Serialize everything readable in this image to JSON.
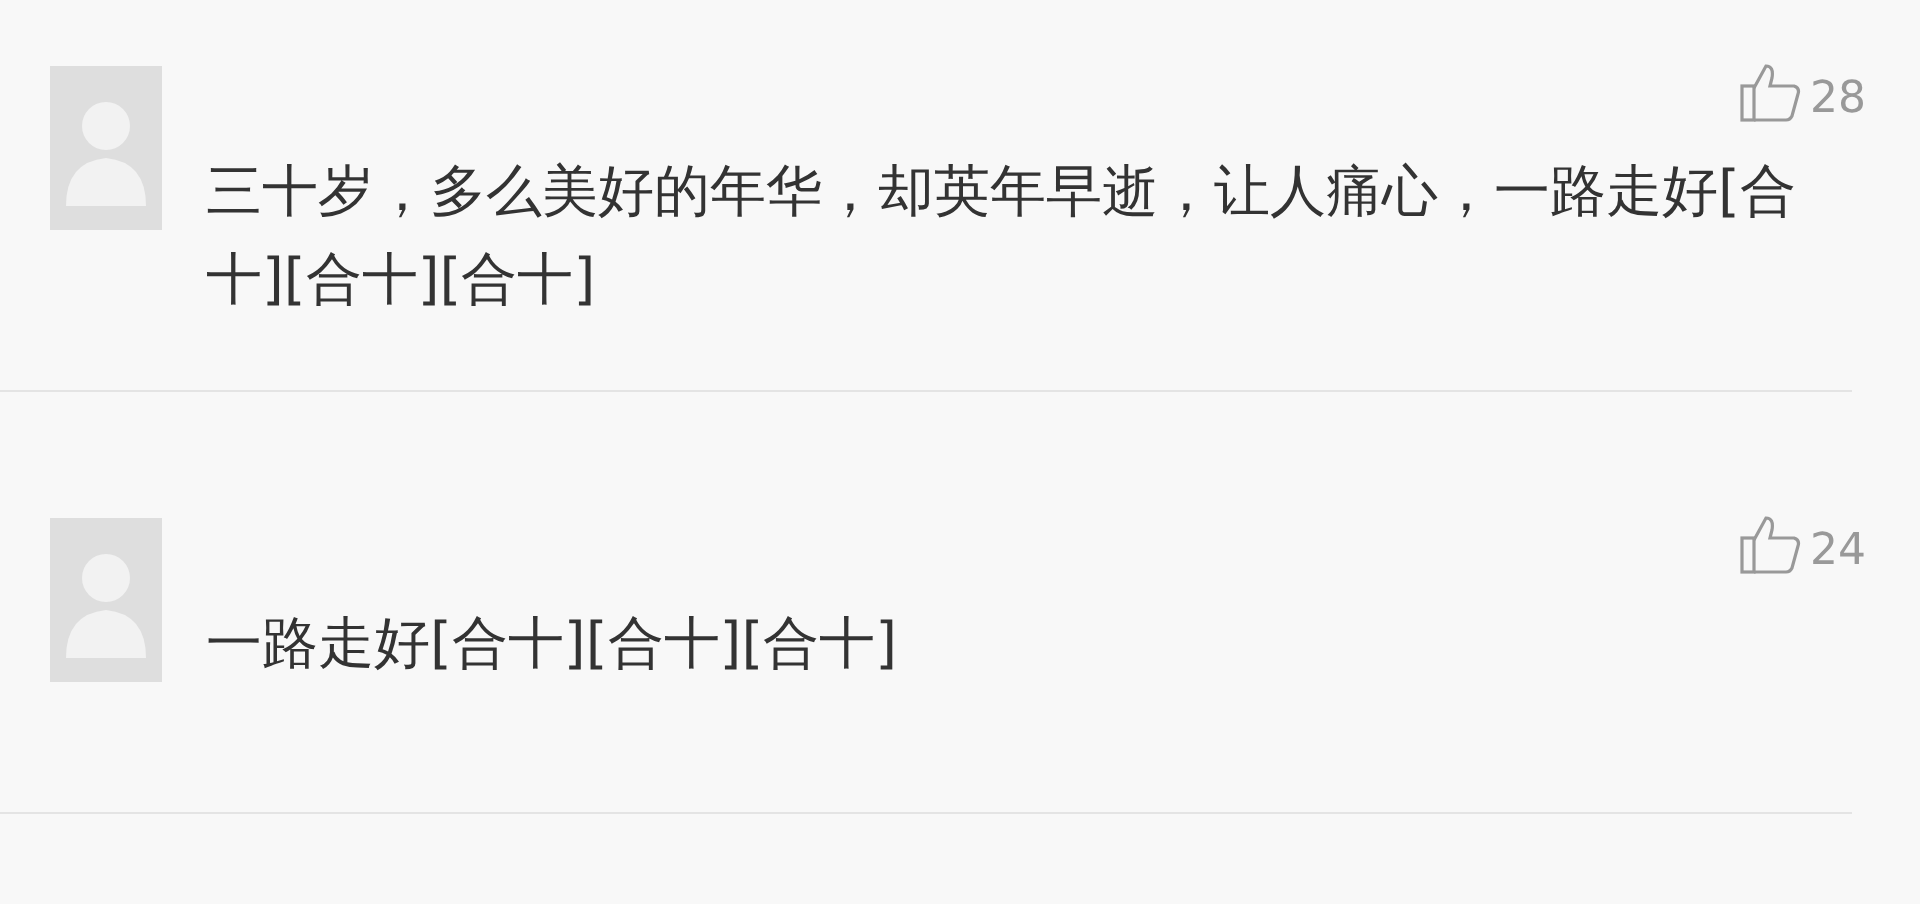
{
  "comments": [
    {
      "likes": "28",
      "text": "三十岁，多么美好的年华，却英年早逝，让人痛心，一路走好[合十][合十][合十]"
    },
    {
      "likes": "24",
      "text": "一路走好[合十][合十][合十]"
    }
  ]
}
